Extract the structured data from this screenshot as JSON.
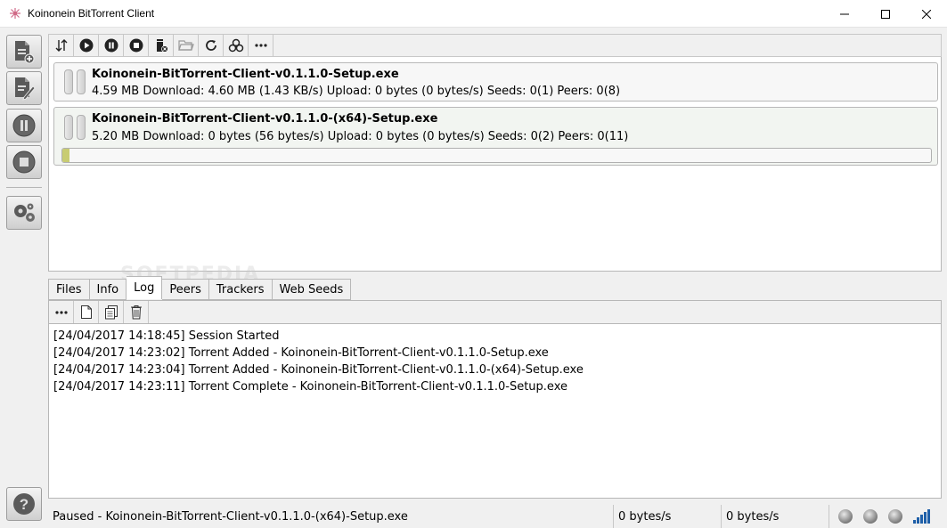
{
  "window": {
    "title": "Koinonein BitTorrent Client"
  },
  "sidebar": {
    "buttons": [
      {
        "icon": "add-torrent-file-icon"
      },
      {
        "icon": "create-torrent-icon"
      },
      {
        "icon": "pause-all-icon"
      },
      {
        "icon": "stop-all-icon"
      },
      {
        "icon": "settings-gears-icon"
      },
      {
        "icon": "help-icon"
      }
    ]
  },
  "toolbar": {
    "buttons": [
      "sort-icon",
      "start-icon",
      "pause-icon",
      "stop-icon",
      "remove-icon",
      "open-folder-icon",
      "recheck-icon",
      "biohazard-icon",
      "more-icon"
    ]
  },
  "torrents": [
    {
      "name": "Koinonein-BitTorrent-Client-v0.1.1.0-Setup.exe",
      "stats": "4.59 MB Download: 4.60 MB (1.43 KB/s) Upload: 0 bytes (0 bytes/s) Seeds: 0(1) Peers: 0(8)"
    },
    {
      "name": "Koinonein-BitTorrent-Client-v0.1.1.0-(x64)-Setup.exe",
      "stats": "5.20 MB Download: 0 bytes (56 bytes/s) Upload: 0 bytes (0 bytes/s) Seeds: 0(2) Peers: 0(11)",
      "progress": 0.008
    }
  ],
  "watermark": "SOFTPEDIA",
  "tabs": [
    {
      "label": "Files"
    },
    {
      "label": "Info"
    },
    {
      "label": "Log",
      "active": true
    },
    {
      "label": "Peers"
    },
    {
      "label": "Trackers"
    },
    {
      "label": "Web Seeds"
    }
  ],
  "log_toolbar": {
    "buttons": [
      "more-icon",
      "new-page-icon",
      "copy-icon",
      "clear-trash-icon"
    ]
  },
  "log": [
    "[24/04/2017 14:18:45] Session Started",
    "[24/04/2017 14:23:02] Torrent Added - Koinonein-BitTorrent-Client-v0.1.1.0-Setup.exe",
    "[24/04/2017 14:23:04] Torrent Added - Koinonein-BitTorrent-Client-v0.1.1.0-(x64)-Setup.exe",
    "[24/04/2017 14:23:11] Torrent Complete - Koinonein-BitTorrent-Client-v0.1.1.0-Setup.exe"
  ],
  "statusbar": {
    "status": "Paused - Koinonein-BitTorrent-Client-v0.1.1.0-(x64)-Setup.exe",
    "download_rate": "0 bytes/s",
    "upload_rate": "0 bytes/s"
  },
  "colors": {
    "progress_fill": "#c8cc72",
    "first_torrent_bg": "#f7f7f7",
    "second_torrent_bg": "#f2f5f1"
  }
}
